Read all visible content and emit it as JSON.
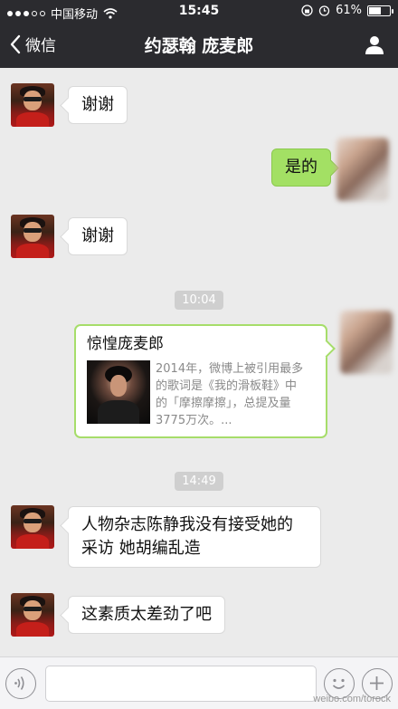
{
  "status_bar": {
    "carrier": "中国移动",
    "time": "15:45",
    "battery_text": "61%",
    "battery_level": 0.61
  },
  "nav": {
    "back_label": "微信",
    "title": "约瑟翰 庞麦郎"
  },
  "messages": [
    {
      "side": "left",
      "text": "谢谢"
    },
    {
      "side": "right",
      "text": "是的"
    },
    {
      "side": "left",
      "text": "谢谢"
    },
    {
      "side": "timestamp",
      "text": "10:04"
    },
    {
      "side": "right-card",
      "title": "惊惶庞麦郎",
      "description": "2014年，微博上被引用最多的歌词是《我的滑板鞋》中的「摩擦摩擦」，总提及量 3775万次。..."
    },
    {
      "side": "timestamp",
      "text": "14:49"
    },
    {
      "side": "left",
      "text": "人物杂志陈静我没有接受她的采访 她胡编乱造"
    },
    {
      "side": "left",
      "text": "这素质太差劲了吧"
    }
  ],
  "input": {
    "placeholder": ""
  },
  "watermark": "weibo.com/torock",
  "colors": {
    "header_bg": "#2b2b2f",
    "chat_bg": "#ebebeb",
    "sent_bubble": "#a3e064",
    "card_border": "#a6dd6a"
  },
  "icons": {
    "back": "chevron-left-icon",
    "profile": "person-icon",
    "voice": "voice-icon",
    "emoji": "emoji-icon",
    "plus": "plus-icon"
  }
}
